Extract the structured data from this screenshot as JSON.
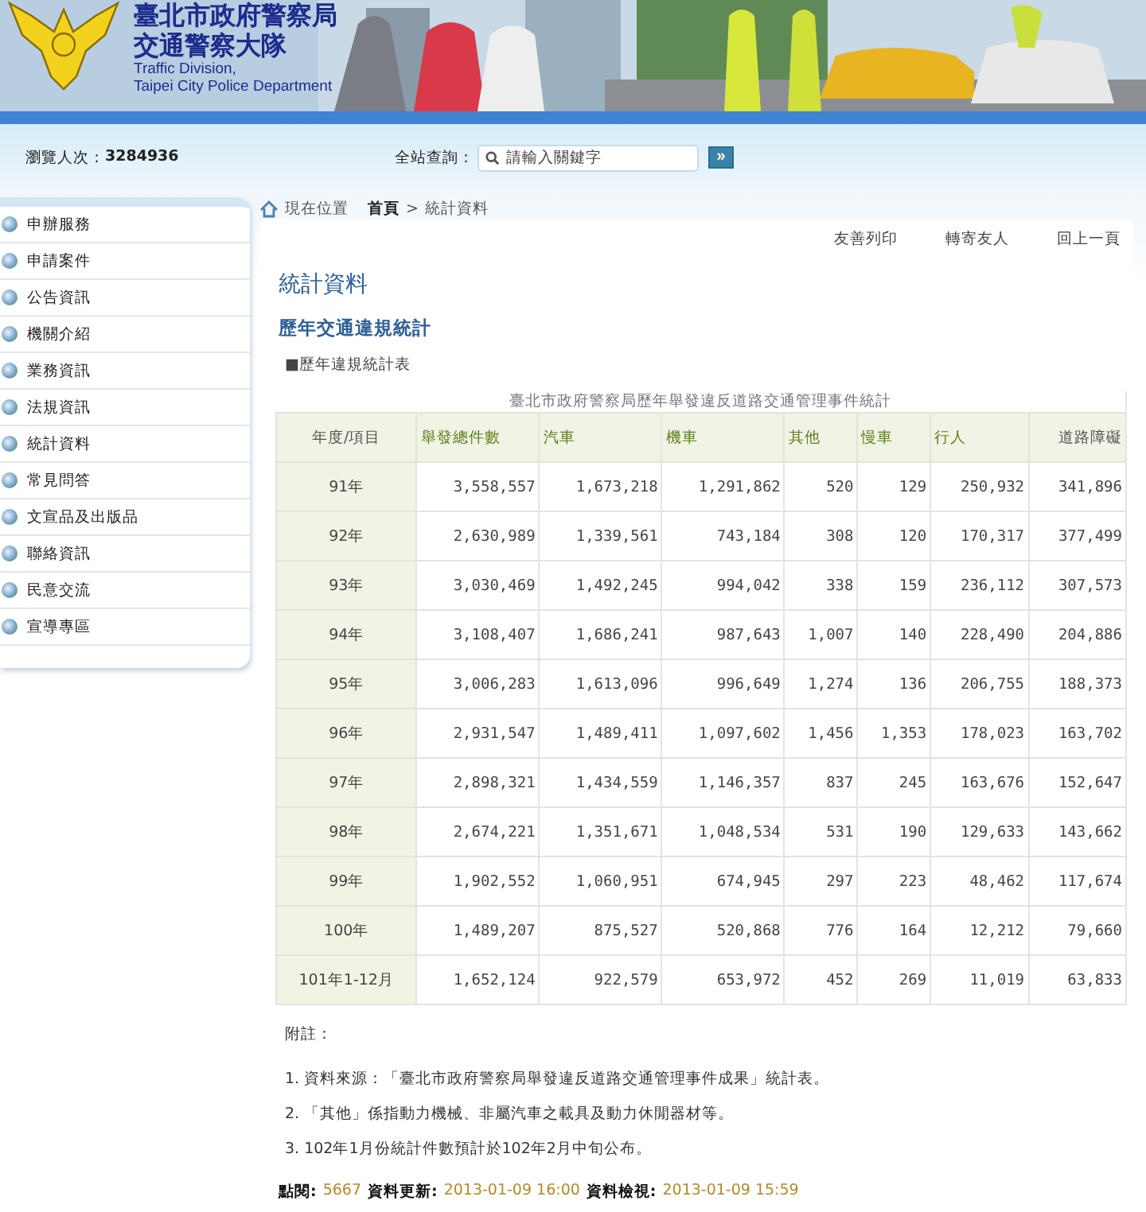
{
  "banner": {
    "title_lines": [
      "臺北市政府警察局",
      "交通警察大隊"
    ],
    "subtitle_lines": [
      "Traffic Division,",
      "Taipei City Police Department"
    ]
  },
  "topbar": {
    "visitor_label": "瀏覽人次：",
    "visitor_count": "3284936",
    "search_label": "全站查詢：",
    "search": {
      "placeholder": "請輸入關鍵字"
    },
    "search_button": "»"
  },
  "sidebar": {
    "items": [
      {
        "label": "申辦服務"
      },
      {
        "label": "申請案件"
      },
      {
        "label": "公告資訊"
      },
      {
        "label": "機關介紹"
      },
      {
        "label": "業務資訊"
      },
      {
        "label": "法規資訊"
      },
      {
        "label": "統計資料"
      },
      {
        "label": "常見問答"
      },
      {
        "label": "文宣品及出版品"
      },
      {
        "label": "聯絡資訊"
      },
      {
        "label": "民意交流"
      },
      {
        "label": "宣導專區"
      }
    ]
  },
  "breadcrumb": {
    "label": "現在位置",
    "items": [
      "首頁",
      "統計資料"
    ],
    "separator": ">"
  },
  "tools": [
    "友善列印",
    "轉寄友人",
    "回上一頁"
  ],
  "page_title": "統計資料",
  "section_title": "歷年交通違規統計",
  "subheading": "■歷年違規統計表",
  "table": {
    "caption": "臺北市政府警察局歷年舉發違反道路交通管理事件統計",
    "columns": [
      {
        "label": "年度/項目",
        "link": false
      },
      {
        "label": "舉發總件數",
        "link": true
      },
      {
        "label": "汽車",
        "link": true
      },
      {
        "label": "機車",
        "link": true
      },
      {
        "label": "其他",
        "link": true
      },
      {
        "label": "慢車",
        "link": true
      },
      {
        "label": "行人",
        "link": true
      },
      {
        "label": "道路障礙",
        "link": false
      }
    ],
    "rows": [
      [
        "91年",
        "3,558,557",
        "1,673,218",
        "1,291,862",
        "520",
        "129",
        "250,932",
        "341,896"
      ],
      [
        "92年",
        "2,630,989",
        "1,339,561",
        "743,184",
        "308",
        "120",
        "170,317",
        "377,499"
      ],
      [
        "93年",
        "3,030,469",
        "1,492,245",
        "994,042",
        "338",
        "159",
        "236,112",
        "307,573"
      ],
      [
        "94年",
        "3,108,407",
        "1,686,241",
        "987,643",
        "1,007",
        "140",
        "228,490",
        "204,886"
      ],
      [
        "95年",
        "3,006,283",
        "1,613,096",
        "996,649",
        "1,274",
        "136",
        "206,755",
        "188,373"
      ],
      [
        "96年",
        "2,931,547",
        "1,489,411",
        "1,097,602",
        "1,456",
        "1,353",
        "178,023",
        "163,702"
      ],
      [
        "97年",
        "2,898,321",
        "1,434,559",
        "1,146,357",
        "837",
        "245",
        "163,676",
        "152,647"
      ],
      [
        "98年",
        "2,674,221",
        "1,351,671",
        "1,048,534",
        "531",
        "190",
        "129,633",
        "143,662"
      ],
      [
        "99年",
        "1,902,552",
        "1,060,951",
        "674,945",
        "297",
        "223",
        "48,462",
        "117,674"
      ],
      [
        "100年",
        "1,489,207",
        "875,527",
        "520,868",
        "776",
        "164",
        "12,212",
        "79,660"
      ],
      [
        "101年1-12月",
        "1,652,124",
        "922,579",
        "653,972",
        "452",
        "269",
        "11,019",
        "63,833"
      ]
    ]
  },
  "notes_heading": "附註：",
  "notes": [
    "1. 資料來源：「臺北市政府警察局舉發違反道路交通管理事件成果」統計表。",
    "2. 「其他」係指動力機械、非屬汽車之載具及動力休閒器材等。",
    "3. 102年1月份統計件數預計於102年2月中旬公布。"
  ],
  "footer": [
    {
      "label": "點閱:",
      "value": "5667"
    },
    {
      "label": "資料更新:",
      "value": "2013-01-09 16:00"
    },
    {
      "label": "資料檢視:",
      "value": "2013-01-09 15:59"
    }
  ]
}
